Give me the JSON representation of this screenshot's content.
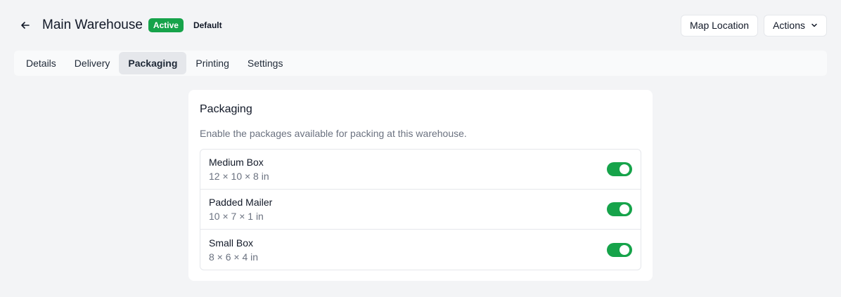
{
  "colors": {
    "accent": "#16a34a"
  },
  "header": {
    "back_icon": "arrow-left-icon",
    "title": "Main Warehouse",
    "status_badge": "Active",
    "default_badge": "Default",
    "map_location_label": "Map Location",
    "actions_label": "Actions",
    "actions_icon": "chevron-down-icon"
  },
  "tabs": [
    {
      "label": "Details",
      "active": false
    },
    {
      "label": "Delivery",
      "active": false
    },
    {
      "label": "Packaging",
      "active": true
    },
    {
      "label": "Printing",
      "active": false
    },
    {
      "label": "Settings",
      "active": false
    }
  ],
  "packaging": {
    "title": "Packaging",
    "description": "Enable the packages available for packing at this warehouse.",
    "items": [
      {
        "name": "Medium Box",
        "dimensions": "12 × 10 × 8 in",
        "enabled": true
      },
      {
        "name": "Padded Mailer",
        "dimensions": "10 × 7 × 1 in",
        "enabled": true
      },
      {
        "name": "Small Box",
        "dimensions": "8 × 6 × 4 in",
        "enabled": true
      }
    ]
  }
}
